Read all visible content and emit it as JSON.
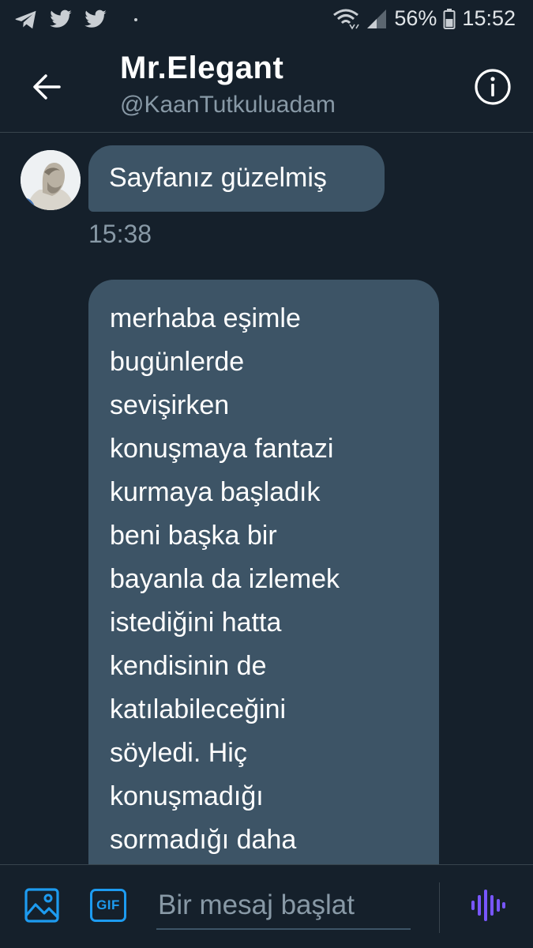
{
  "status_bar": {
    "battery": "56%",
    "time": "15:52",
    "left_icons": [
      "telegram-icon",
      "twitter-icon",
      "twitter-icon"
    ],
    "right_icons": [
      "wifi-icon",
      "signal-icon",
      "battery-icon"
    ]
  },
  "header": {
    "title": "Mr.Elegant",
    "handle": "@KaanTutkuluadam",
    "back_icon": "arrow-left-icon",
    "info_icon": "info-icon"
  },
  "messages": [
    {
      "text": "Sayfanız güzelmiş",
      "time": "15:38"
    },
    {
      "lines": [
        "merhaba eşimle",
        "bugünlerde",
        "sevişirken",
        "konuşmaya fantazi",
        "kurmaya başladık",
        "beni başka bir",
        "bayanla da izlemek",
        "istediğini hatta",
        "kendisinin de",
        "katılabileceğini",
        "söyledi. Hiç",
        "konuşmadığı",
        "sormadığı daha"
      ]
    }
  ],
  "composer": {
    "placeholder": "Bir mesaj başlat",
    "gif_label": "GIF",
    "media_icon": "image-icon",
    "voice_icon": "voice-waveform-icon"
  },
  "colors": {
    "background": "#15202b",
    "bubble": "#3d5466",
    "accent": "#1d9bf0",
    "voice": "#7856ff",
    "muted_text": "#8899a6"
  }
}
